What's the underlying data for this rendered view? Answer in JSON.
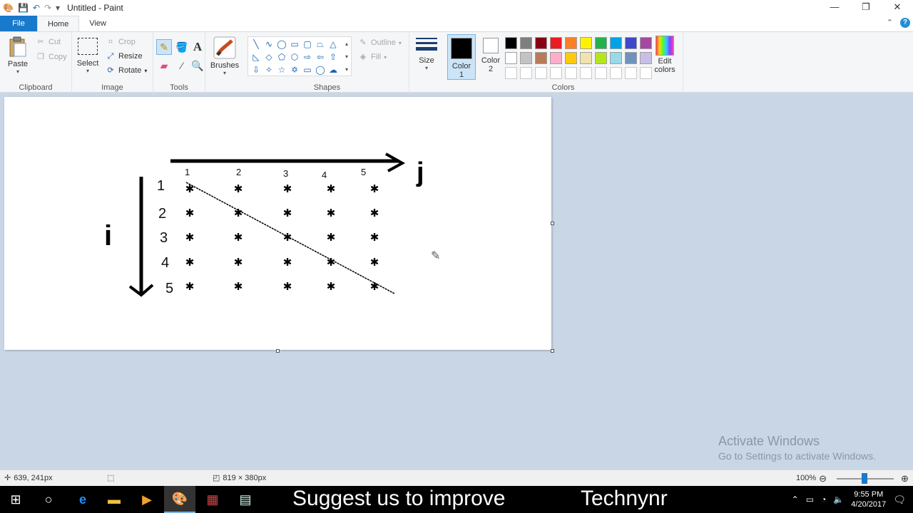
{
  "titlebar": {
    "title": "Untitled - Paint",
    "quick_access": [
      "app-icon",
      "save-icon",
      "undo-icon",
      "redo-icon",
      "customize-icon"
    ],
    "buttons": {
      "minimize": "—",
      "restore": "❐",
      "close": "✕"
    }
  },
  "tabs": {
    "file": "File",
    "home": "Home",
    "view": "View"
  },
  "ribbon": {
    "clipboard": {
      "label": "Clipboard",
      "paste": "Paste",
      "cut": "Cut",
      "copy": "Copy"
    },
    "image": {
      "label": "Image",
      "select": "Select",
      "crop": "Crop",
      "resize": "Resize",
      "rotate": "Rotate"
    },
    "tools": {
      "label": "Tools"
    },
    "brushes": {
      "label": "Brushes"
    },
    "shapes": {
      "label": "Shapes",
      "outline": "Outline",
      "fill": "Fill"
    },
    "size": {
      "label": "Size"
    },
    "colors": {
      "label": "Colors",
      "color1_label": "Color\n1",
      "color2_label": "Color\n2",
      "color1": "#000000",
      "color2": "#ffffff",
      "edit": "Edit\ncolors",
      "palette_row1": [
        "#000000",
        "#7f7f7f",
        "#880015",
        "#ed1c24",
        "#ff7f27",
        "#fff200",
        "#22b14c",
        "#00a2e8",
        "#3f48cc",
        "#a349a4"
      ],
      "palette_row2": [
        "#ffffff",
        "#c3c3c3",
        "#b97a57",
        "#ffaec9",
        "#ffc90e",
        "#efe4b0",
        "#b5e61d",
        "#99d9ea",
        "#7092be",
        "#c8bfe7"
      ],
      "palette_row3": [
        "#ffffff",
        "#ffffff",
        "#ffffff",
        "#ffffff",
        "#ffffff",
        "#ffffff",
        "#ffffff",
        "#ffffff",
        "#ffffff",
        "#ffffff"
      ]
    }
  },
  "canvas": {
    "label_j": "j",
    "label_i": "i",
    "col_labels": [
      "1",
      "2",
      "3",
      "4",
      "5"
    ],
    "row_labels": [
      "1",
      "2",
      "3",
      "4",
      "5"
    ]
  },
  "watermark": {
    "title": "Activate Windows",
    "subtitle": "Go to Settings to activate Windows."
  },
  "status": {
    "cursor_pos": "639, 241px",
    "canvas_size": "819 × 380px",
    "zoom": "100%"
  },
  "taskbar": {
    "overlay_left": "Suggest us to improve",
    "overlay_right": "Technynr",
    "time": "9:55 PM",
    "date": "4/20/2017"
  }
}
